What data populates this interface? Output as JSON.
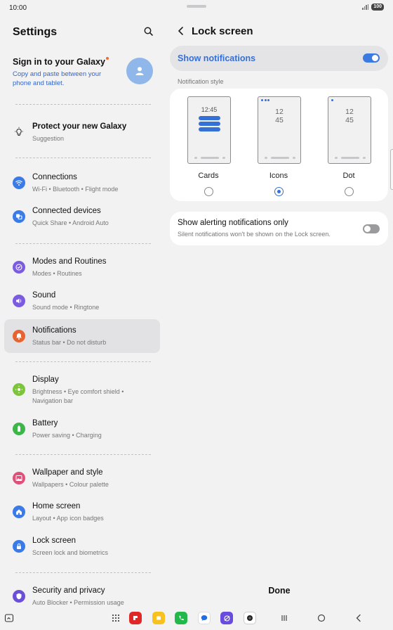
{
  "status_bar": {
    "time": "10:00",
    "battery": "100"
  },
  "left": {
    "title": "Settings",
    "account": {
      "title": "Sign in to your Galaxy",
      "subtitle": "Copy and paste between your phone and tablet."
    },
    "suggestion": {
      "title": "Protect your new Galaxy",
      "subtitle": "Suggestion"
    },
    "items": [
      {
        "title": "Connections",
        "subtitle": "Wi-Fi  •  Bluetooth  •  Flight mode",
        "icon": "wifi-icon",
        "color": "#3a7be8"
      },
      {
        "title": "Connected devices",
        "subtitle": "Quick Share  •  Android Auto",
        "icon": "devices-icon",
        "color": "#3a7be8"
      },
      {
        "title": "Modes and Routines",
        "subtitle": "Modes  •  Routines",
        "icon": "check-circle-icon",
        "color": "#7b5ce0"
      },
      {
        "title": "Sound",
        "subtitle": "Sound mode  •  Ringtone",
        "icon": "volume-icon",
        "color": "#7b5ce0"
      },
      {
        "title": "Notifications",
        "subtitle": "Status bar  •  Do not disturb",
        "icon": "bell-icon",
        "color": "#e8632f"
      },
      {
        "title": "Display",
        "subtitle": "Brightness  •  Eye comfort shield  •  Navigation bar",
        "icon": "sun-icon",
        "color": "#7cc43a"
      },
      {
        "title": "Battery",
        "subtitle": "Power saving  •  Charging",
        "icon": "battery-icon",
        "color": "#3cb64a"
      },
      {
        "title": "Wallpaper and style",
        "subtitle": "Wallpapers  •  Colour palette",
        "icon": "image-icon",
        "color": "#e0507a"
      },
      {
        "title": "Home screen",
        "subtitle": "Layout  •  App icon badges",
        "icon": "home-icon",
        "color": "#3a7be8"
      },
      {
        "title": "Lock screen",
        "subtitle": "Screen lock and biometrics",
        "icon": "lock-icon",
        "color": "#3a7be8"
      },
      {
        "title": "Security and privacy",
        "subtitle": "Auto Blocker  •  Permission usage",
        "icon": "shield-icon",
        "color": "#6b4fd6"
      }
    ]
  },
  "right": {
    "title": "Lock screen",
    "show_notifications": {
      "label": "Show notifications",
      "enabled": true
    },
    "style_label": "Notification style",
    "styles": [
      {
        "label": "Cards",
        "preview_time": "12:45",
        "selected": false
      },
      {
        "label": "Icons",
        "preview_hour": "12",
        "preview_minute": "45",
        "selected": true
      },
      {
        "label": "Dot",
        "preview_hour": "12",
        "preview_minute": "45",
        "selected": false
      }
    ],
    "alerting": {
      "title": "Show alerting notifications only",
      "subtitle": "Silent notifications won't be shown on the Lock screen.",
      "enabled": false
    },
    "done": "Done"
  },
  "navbar": {
    "apps": [
      "apps-grid-icon",
      "flipboard-icon",
      "notes-icon",
      "phone-icon",
      "messages-icon",
      "internet-icon",
      "camera-icon"
    ]
  }
}
